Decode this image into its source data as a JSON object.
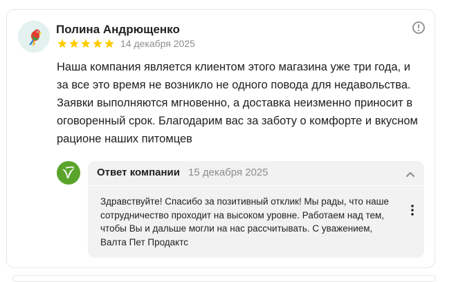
{
  "review": {
    "author": "Полина Андрющенко",
    "avatar_icon": "parrot-icon",
    "rating": 5,
    "star_color": "#ffcc00",
    "date": "14 декабря 2025",
    "text": "Наша компания является клиентом этого магазина уже три года, и за все это время не возникло не одного повода для недавольства. Заявки выполняются мгновенно, а доставка неизменно приносит в оговоренный срок. Благодарим вас за заботу о комфорте и вкусном рационе наших питомцев"
  },
  "reply": {
    "logo_icon": "company-logo-icon",
    "logo_color": "#5ba42c",
    "title": "Ответ компании",
    "date": "15 декабря 2025",
    "text": "Здравствуйте! Спасибо за позитивный отклик! Мы рады, что наше сотрудничество проходит на высоком уровне. Работаем над тем, чтобы Вы и дальше могли на нас рассчитывать. С уважением, Валта Пет Продактс"
  }
}
